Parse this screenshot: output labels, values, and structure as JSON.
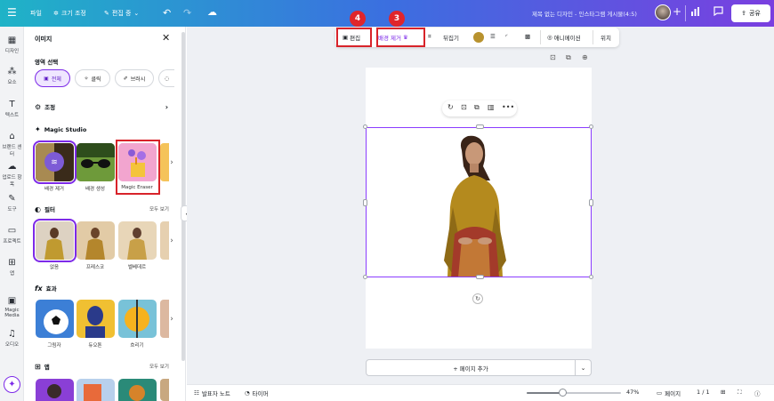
{
  "topbar": {
    "file": "파일",
    "resize": "크기 조정",
    "edit_mode": "편집 중",
    "doc_title": "제목 없는 디자인 - 인스타그램 게시물(4:5)",
    "share": "공유"
  },
  "rail": [
    {
      "label": "디자인",
      "icon": "layout-icon"
    },
    {
      "label": "요소",
      "icon": "shapes-icon"
    },
    {
      "label": "텍스트",
      "icon": "text-icon"
    },
    {
      "label": "브랜드 센터",
      "icon": "brand-icon"
    },
    {
      "label": "업로드 항목",
      "icon": "upload-cloud-icon"
    },
    {
      "label": "도구",
      "icon": "pen-icon"
    },
    {
      "label": "프로젝트",
      "icon": "folder-icon"
    },
    {
      "label": "앱",
      "icon": "apps-icon"
    },
    {
      "label": "Magic Media",
      "icon": "magic-media-icon"
    },
    {
      "label": "오디오",
      "icon": "music-note-icon"
    }
  ],
  "panel": {
    "title": "이미지",
    "area_select_label": "영역 선택",
    "chips": [
      "전체",
      "클릭",
      "브러시"
    ],
    "adjust_label": "조정",
    "magic_studio_label": "Magic Studio",
    "magic_tools": [
      "배경 제거",
      "배경 생성",
      "Magic Eraser"
    ],
    "filter_label": "필터",
    "filters": [
      "없음",
      "프레스코",
      "벨베데르"
    ],
    "effects_label": "효과",
    "effects": [
      "그림자",
      "듀오톤",
      "흐리기"
    ],
    "apps_label": "앱",
    "see_all": "모두 보기"
  },
  "context_bar": {
    "edit": "편집",
    "bg_remove": "배경 제거",
    "flip": "뒤집기",
    "animate": "애니메이션",
    "position": "위치",
    "fill_color": "#b8922e"
  },
  "annotations": {
    "badge_edit": "4",
    "badge_bg_remove": "3"
  },
  "canvas": {
    "add_page": "+ 페이지 추가"
  },
  "bottombar": {
    "notes": "발표자 노트",
    "timer": "타이머",
    "zoom": "47%",
    "pages_label": "페이지",
    "page_count": "1 / 1",
    "zoom_fraction": 0.38
  }
}
